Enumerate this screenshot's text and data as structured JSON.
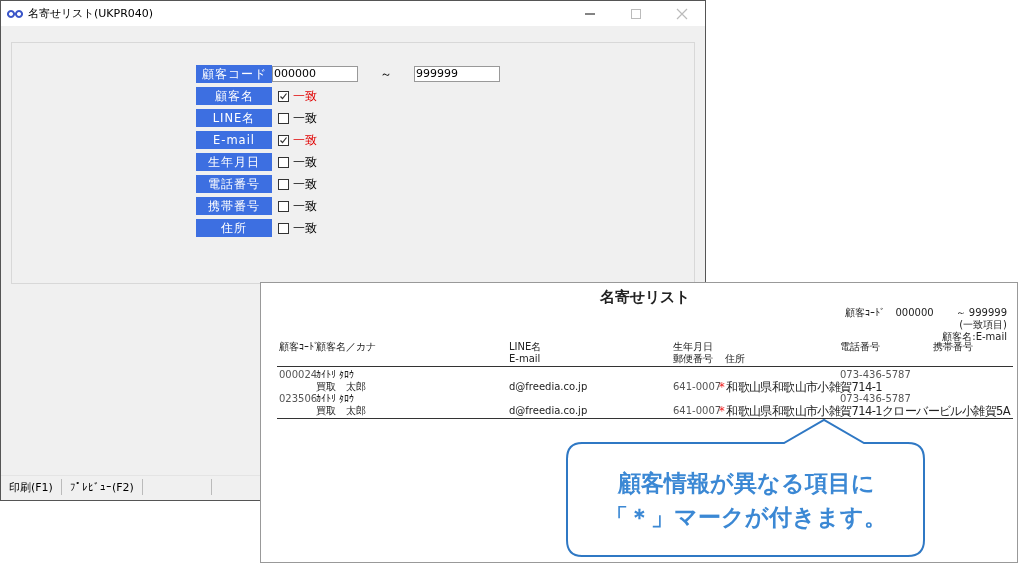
{
  "window": {
    "title": "名寄せリスト(UKPR040)",
    "customer_code": {
      "label": "顧客コード",
      "from": "000000",
      "separator": "～",
      "to": "999999"
    },
    "match_fields": [
      {
        "label": "顧客名",
        "checked": true,
        "option": "一致"
      },
      {
        "label": "LINE名",
        "checked": false,
        "option": "一致"
      },
      {
        "label": "E-mail",
        "checked": true,
        "option": "一致"
      },
      {
        "label": "生年月日",
        "checked": false,
        "option": "一致"
      },
      {
        "label": "電話番号",
        "checked": false,
        "option": "一致"
      },
      {
        "label": "携帯番号",
        "checked": false,
        "option": "一致"
      },
      {
        "label": "住所",
        "checked": false,
        "option": "一致"
      }
    ],
    "status_bar": [
      "印刷(F1)",
      "ﾌﾟﾚﾋﾞｭｰ(F2)"
    ]
  },
  "report": {
    "title": "名寄せリスト",
    "criteria": {
      "label": "顧客ｺｰﾄﾞ",
      "from": "000000",
      "to": "～ 999999",
      "match_heading": "(一致項目)",
      "match_items": "顧客名:E-mail"
    },
    "headers_line_1": [
      "顧客ｺｰﾄﾞ",
      "顧客名／カナ",
      "LINE名",
      "生年月日",
      "電話番号",
      "携帯番号"
    ],
    "headers_line_2": [
      "E-mail",
      "郵便番号",
      "住所"
    ],
    "rows": [
      {
        "code": "000024",
        "kana": "ｶｲﾄﾘ ﾀﾛｳ",
        "name": "買取　太郎",
        "email": "d@freedia.co.jp",
        "phone": "073-436-5787",
        "postal": "641-0007",
        "mark": "*",
        "address": "和歌山県和歌山市小雑賀714-1"
      },
      {
        "code": "023506",
        "kana": "ｶｲﾄﾘ ﾀﾛｳ",
        "name": "買取　太郎",
        "email": "d@freedia.co.jp",
        "phone": "073-436-5787",
        "postal": "641-0007",
        "mark": "*",
        "address": "和歌山県和歌山市小雑賀714-1クローバービル小雑賀5A"
      }
    ]
  },
  "callout": {
    "lines": [
      "顧客情報が異なる項目に",
      "「＊」マークが付きます。"
    ]
  }
}
